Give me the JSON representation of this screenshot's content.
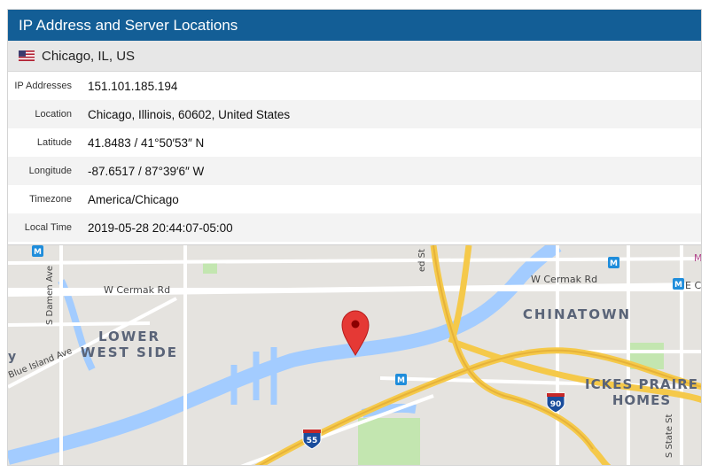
{
  "panel": {
    "title": "IP Address and Server Locations",
    "location_heading": "Chicago, IL, US"
  },
  "info": {
    "rows": [
      {
        "label": "IP Addresses",
        "value": "151.101.185.194"
      },
      {
        "label": "Location",
        "value": "Chicago, Illinois, 60602, United States"
      },
      {
        "label": "Latitude",
        "value": "41.8483 / 41°50′53″ N"
      },
      {
        "label": "Longitude",
        "value": "-87.6517 / 87°39′6″ W"
      },
      {
        "label": "Timezone",
        "value": "America/Chicago"
      },
      {
        "label": "Local Time",
        "value": "2019-05-28 20:44:07-05:00"
      }
    ]
  },
  "map": {
    "labels": {
      "cermak_left": "W Cermak Rd",
      "cermak_right": "W Cermak Rd",
      "damen": "S Damen Ave",
      "blue_island": "Blue Island Ave",
      "lower_west_side_1": "LOWER",
      "lower_west_side_2": "WEST SIDE",
      "chinatown": "CHINATOWN",
      "ickes_1": "ICKES PRAIRE",
      "ickes_2": "HOMES",
      "state_st": "S State St",
      "ed_st": "ed St",
      "e_ce": "E Ce",
      "m_edge": "M",
      "y_edge": "y",
      "i55": "55",
      "i90": "90",
      "metro": "M"
    },
    "colors": {
      "land": "#e5e3df",
      "water": "#a3ccff",
      "highway": "#f5c94a",
      "park": "#c3e6b0",
      "marker": "#e53935"
    }
  }
}
